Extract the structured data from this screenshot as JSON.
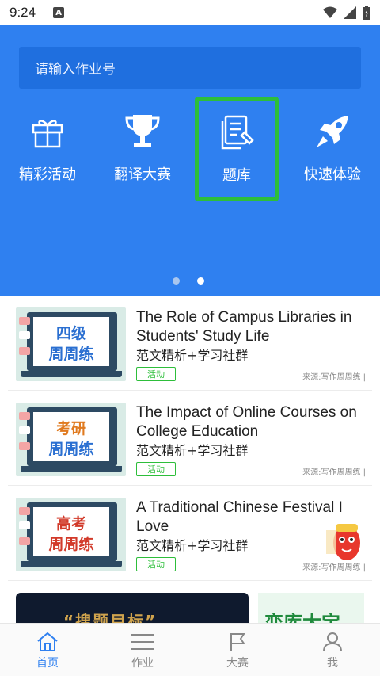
{
  "status_bar": {
    "time": "9:24",
    "a_badge": "A"
  },
  "search": {
    "placeholder": "请输入作业号"
  },
  "categories": [
    {
      "label": "精彩活动",
      "icon": "gift-icon"
    },
    {
      "label": "翻译大赛",
      "icon": "trophy-icon"
    },
    {
      "label": "题库",
      "icon": "question-bank-icon",
      "highlighted": true
    },
    {
      "label": "快速体验",
      "icon": "rocket-icon"
    }
  ],
  "carousel": {
    "pages": 2,
    "active": 2
  },
  "articles": [
    {
      "title": "The Role of Campus Libraries in Students' Study Life",
      "subtitle": "范文精析+学习社群",
      "tag": "活动",
      "source": "来源:写作周周练 |",
      "thumb_line1": "四级",
      "thumb_line2": "周周练",
      "thumb_color": "#2a6fd1"
    },
    {
      "title": "The Impact of Online Courses on College Education",
      "subtitle": "范文精析+学习社群",
      "tag": "活动",
      "source": "来源:写作周周练 |",
      "thumb_line1": "考研",
      "thumb_line2": "周周练",
      "thumb_color": "#e07a1f"
    },
    {
      "title": "A Traditional Chinese Festival I Love",
      "subtitle": "范文精析+学习社群",
      "tag": "活动",
      "source": "来源:写作周周练 |",
      "thumb_line1": "高考",
      "thumb_line2": "周周练",
      "thumb_color": "#d23a2a"
    }
  ],
  "banners": {
    "left_text": "“搜题目标”",
    "right_text": "恋库大宝"
  },
  "tab_bar": [
    {
      "label": "首页",
      "icon": "home-icon",
      "active": true
    },
    {
      "label": "作业",
      "icon": "menu-icon",
      "active": false
    },
    {
      "label": "大赛",
      "icon": "flag-icon",
      "active": false
    },
    {
      "label": "我",
      "icon": "user-icon",
      "active": false
    }
  ],
  "colors": {
    "primary": "#2f80f0",
    "highlight": "#2dbe3a",
    "tab_active": "#2f80f0",
    "tab_inactive": "#888888"
  }
}
